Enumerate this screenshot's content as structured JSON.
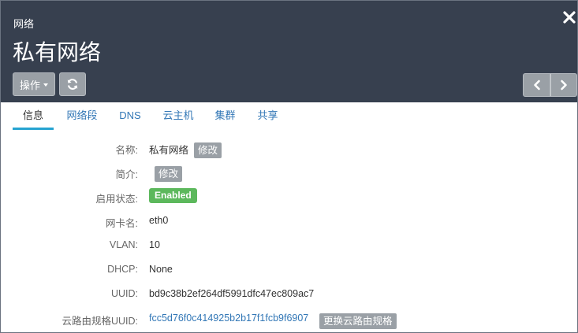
{
  "header": {
    "subtitle": "网络",
    "title": "私有网络",
    "actions_label": "操作"
  },
  "icons": {
    "close": "close-icon",
    "refresh": "refresh-icon",
    "prev": "chevron-left-icon",
    "next": "chevron-right-icon"
  },
  "tabs": [
    {
      "label": "信息",
      "active": true
    },
    {
      "label": "网络段",
      "active": false
    },
    {
      "label": "DNS",
      "active": false
    },
    {
      "label": "云主机",
      "active": false
    },
    {
      "label": "集群",
      "active": false
    },
    {
      "label": "共享",
      "active": false
    }
  ],
  "details": {
    "name": {
      "label": "名称:",
      "value": "私有网络",
      "edit_label": "修改"
    },
    "description": {
      "label": "简介:",
      "edit_label": "修改"
    },
    "status": {
      "label": "启用状态:",
      "value": "Enabled",
      "color": "#5cb85c"
    },
    "nic": {
      "label": "网卡名:",
      "value": "eth0"
    },
    "vlan": {
      "label": "VLAN:",
      "value": "10"
    },
    "dhcp": {
      "label": "DHCP:",
      "value": "None"
    },
    "uuid": {
      "label": "UUID:",
      "value": "bd9c38b2ef264df5991dfc47ec809ac7"
    },
    "router_spec": {
      "label": "云路由规格UUID:",
      "value": "fcc5d76f0c414925b2b17f1fcb9f6907",
      "change_label": "更换云路由规格"
    }
  },
  "colors": {
    "header_bg": "#37404f",
    "accent": "#26a3d1",
    "link": "#3277b6",
    "button": "#9aa0a6"
  }
}
